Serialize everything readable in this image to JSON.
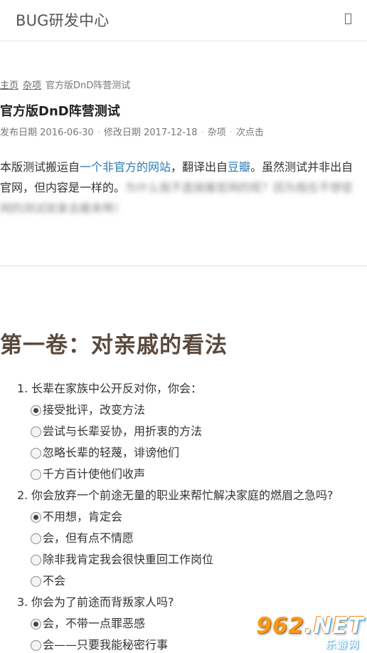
{
  "header": {
    "site_title": "BUG研发中心",
    "menu_icon": "menu-icon"
  },
  "breadcrumb": {
    "home": "主页",
    "category": "杂项",
    "current": "官方版DnD阵营测试"
  },
  "post": {
    "title": "官方版DnD阵营测试",
    "published_label": "发布日期",
    "published_date": "2016-06-30",
    "modified_label": "修改日期",
    "modified_date": "2017-12-18",
    "category": "杂项",
    "views": "次点击",
    "intro_part1": "本版测试搬运自",
    "intro_link1": "一个非官方的网站",
    "intro_part2": "，翻译出自",
    "intro_link2": "豆瓣",
    "intro_part3": "。虽然测试并非出自官网，但内容是一样的。",
    "intro_blurred": "为什么我不直接搬官网的呢？因为我在不想官网的测试就拿去搬来啊！"
  },
  "volume": {
    "title": "第一卷：对亲戚的看法"
  },
  "questions": [
    {
      "number": "1.",
      "text": "长辈在家族中公开反对你，你会：",
      "options": [
        {
          "label": "接受批评，改变方法",
          "checked": true
        },
        {
          "label": "尝试与长辈妥协，用折衷的方法",
          "checked": false
        },
        {
          "label": "忽略长辈的轻蔑，诽谤他们",
          "checked": false
        },
        {
          "label": "千方百计使他们收声",
          "checked": false
        }
      ]
    },
    {
      "number": "2.",
      "text": "你会放弃一个前途无量的职业来帮忙解决家庭的燃眉之急吗?",
      "options": [
        {
          "label": "不用想，肯定会",
          "checked": true
        },
        {
          "label": "会，但有点不情愿",
          "checked": false
        },
        {
          "label": "除非我肯定我会很快重回工作岗位",
          "checked": false
        },
        {
          "label": "不会",
          "checked": false
        }
      ]
    },
    {
      "number": "3.",
      "text": "你会为了前途而背叛家人吗?",
      "options": [
        {
          "label": "会，不带一点罪恶感",
          "checked": true
        },
        {
          "label": "会——只要我能秘密行事",
          "checked": false
        }
      ]
    }
  ],
  "watermark": {
    "logo": "962",
    "logo_suffix": ".NET",
    "sub": "乐游网"
  }
}
